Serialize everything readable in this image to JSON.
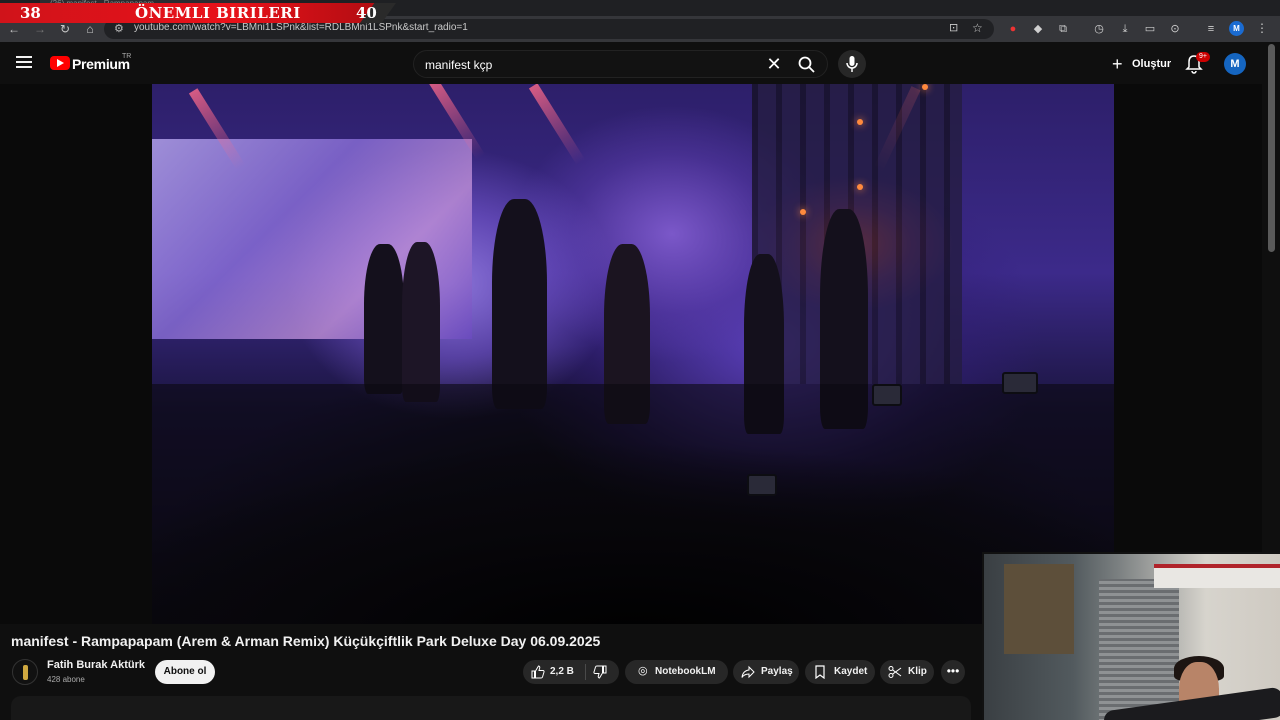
{
  "browser": {
    "tab_title": "(26) manifest - Rampapapam",
    "url": "youtube.com/watch?v=LBMni1LSPnk&list=RDLBMni1LSPnk&start_radio=1",
    "profile_initial": "M"
  },
  "overlay_banner": {
    "left_number": "38",
    "title": "ÖNEMLI BIRILERI",
    "right_number": "40"
  },
  "header": {
    "brand": "Premium",
    "region": "TR",
    "search_query": "manifest kçp",
    "create_label": "Oluştur",
    "notification_badge": "9+",
    "avatar_initial": "M"
  },
  "video": {
    "title": "manifest - Rampapapam (Arem & Arman Remix) Küçükçiftlik Park Deluxe Day 06.09.2025"
  },
  "channel": {
    "name": "Fatih Burak Aktürk",
    "subscribers": "428 abone",
    "subscribe_label": "Abone ol"
  },
  "actions": {
    "like_count": "2,2 B",
    "notebooklm_label": "NotebookLM",
    "share_label": "Paylaş",
    "save_label": "Kaydet",
    "clip_label": "Klip",
    "more_label": "•••"
  },
  "icons": {
    "back": "arrow-left-icon",
    "forward": "arrow-right-icon",
    "reload": "reload-icon",
    "home": "home-icon",
    "search": "search-icon",
    "mic": "microphone-icon",
    "bell": "bell-icon",
    "like": "thumbs-up-icon",
    "dislike": "thumbs-down-icon",
    "share": "share-icon",
    "save": "bookmark-icon",
    "clip": "scissors-icon"
  },
  "colors": {
    "youtube_red": "#ff0000",
    "banner_red": "#e8121a",
    "background": "#0f0f0f",
    "pill": "#272727"
  }
}
